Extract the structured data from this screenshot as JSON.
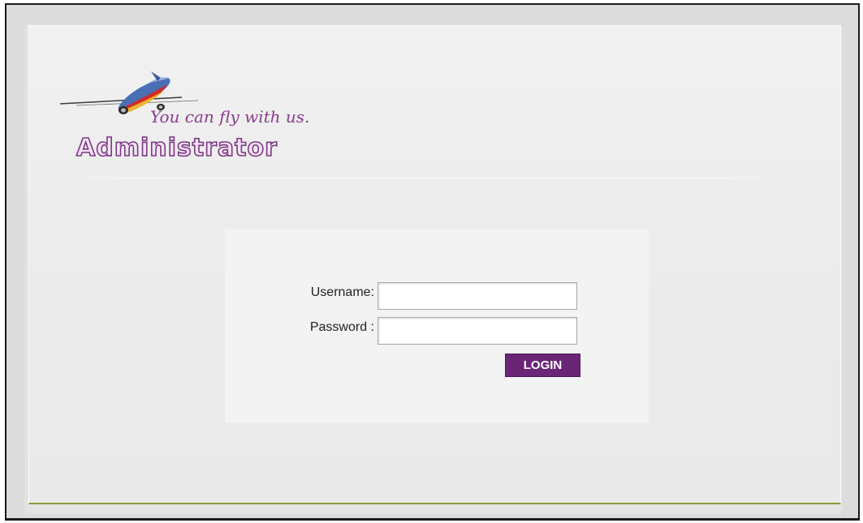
{
  "header": {
    "tagline": "You can fly with us.",
    "title": "Administrator",
    "logo_icon": "airplane-icon"
  },
  "login_form": {
    "username_label": "Username:",
    "username_value": "",
    "password_label": "Password :",
    "password_value": "",
    "submit_label": "LOGIN"
  },
  "colors": {
    "brand_purple": "#6a2577",
    "title_outline": "#7b3a82",
    "bottom_accent": "#8a9a3a"
  }
}
